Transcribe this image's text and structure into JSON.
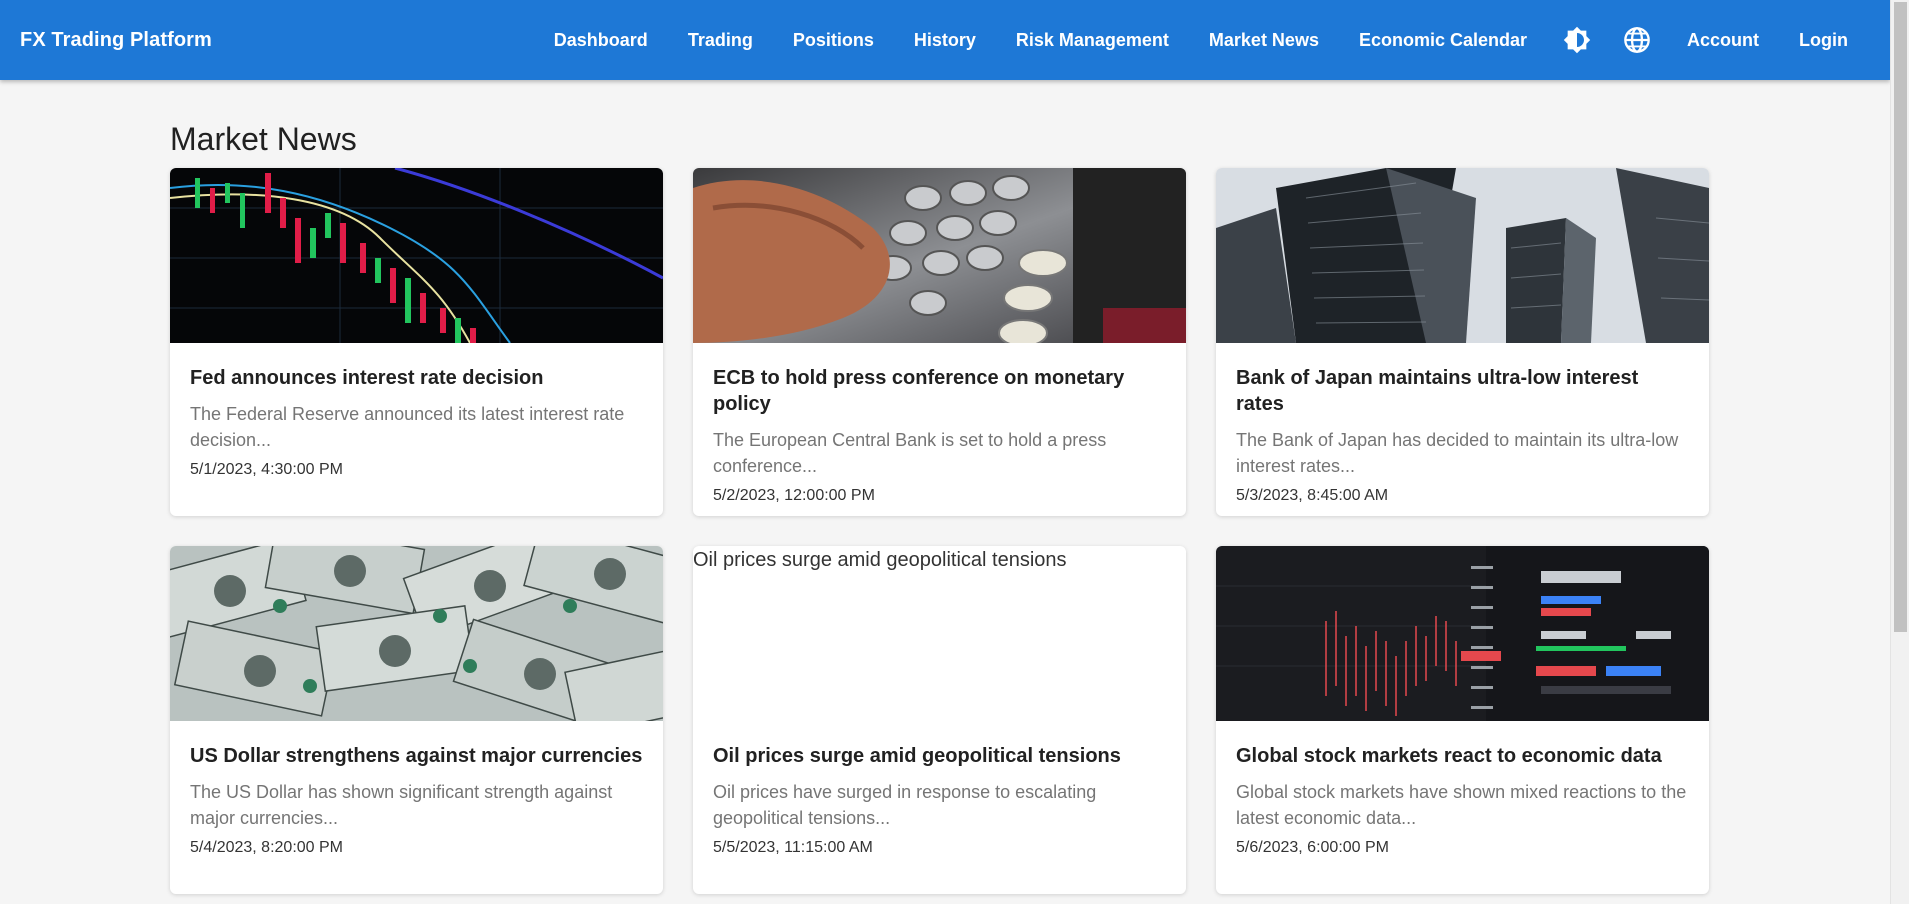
{
  "app": {
    "title": "FX Trading Platform"
  },
  "nav": {
    "links": [
      "Dashboard",
      "Trading",
      "Positions",
      "History",
      "Risk Management",
      "Market News",
      "Economic Calendar"
    ],
    "icons": [
      "theme-toggle-icon",
      "language-globe-icon"
    ],
    "account": "Account",
    "login": "Login"
  },
  "page": {
    "title": "Market News"
  },
  "articles": [
    {
      "title": "Fed announces interest rate decision",
      "summary": "The Federal Reserve announced its latest interest rate decision...",
      "date": "5/1/2023, 4:30:00 PM",
      "image": "candlestick-chart-photo"
    },
    {
      "title": "ECB to hold press conference on monetary policy",
      "summary": "The European Central Bank is set to hold a press conference...",
      "date": "5/2/2023, 12:00:00 PM",
      "image": "atm-keypad-photo"
    },
    {
      "title": "Bank of Japan maintains ultra-low interest rates",
      "summary": "The Bank of Japan has decided to maintain its ultra-low interest rates...",
      "date": "5/3/2023, 8:45:00 AM",
      "image": "skyscrapers-photo"
    },
    {
      "title": "US Dollar strengthens against major currencies",
      "summary": "The US Dollar has shown significant strength against major currencies...",
      "date": "5/4/2023, 8:20:00 PM",
      "image": "dollar-bills-photo"
    },
    {
      "title": "Oil prices surge amid geopolitical tensions",
      "summary": "Oil prices have surged in response to escalating geopolitical tensions...",
      "date": "5/5/2023, 11:15:00 AM",
      "image_alt": "Oil prices surge amid geopolitical tensions"
    },
    {
      "title": "Global stock markets react to economic data",
      "summary": "Global stock markets have shown mixed reactions to the latest economic data...",
      "date": "5/6/2023, 6:00:00 PM",
      "image": "trading-terminal-photo"
    }
  ],
  "colors": {
    "appbar": "#1e78d6",
    "background": "#f5f5f5"
  }
}
